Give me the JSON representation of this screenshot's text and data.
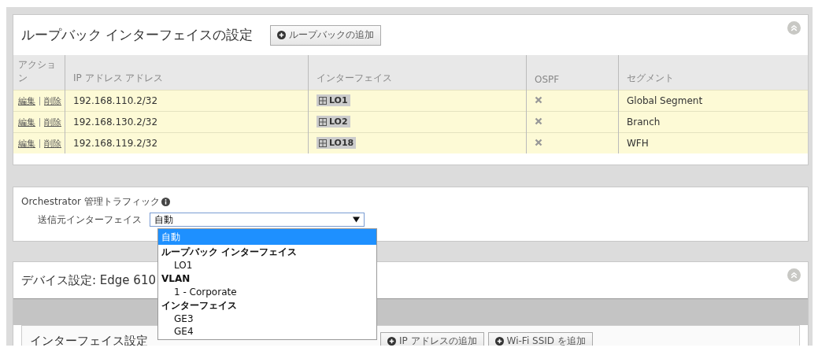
{
  "loopback": {
    "title": "ループバック インターフェイスの設定",
    "add_button": "ループバックの追加",
    "columns": [
      "アクション",
      "IP アドレス アドレス",
      "インターフェイス",
      "OSPF",
      "セグメント"
    ],
    "rows": [
      {
        "edit": "編集",
        "delete": "削除",
        "ip": "192.168.110.2/32",
        "interface": "LO1",
        "ospf": false,
        "segment": "Global Segment"
      },
      {
        "edit": "編集",
        "delete": "削除",
        "ip": "192.168.130.2/32",
        "interface": "LO2",
        "ospf": false,
        "segment": "Branch"
      },
      {
        "edit": "編集",
        "delete": "削除",
        "ip": "192.168.119.2/32",
        "interface": "LO18",
        "ospf": false,
        "segment": "WFH"
      }
    ]
  },
  "management": {
    "label": "Orchestrator 管理トラフィック",
    "source_label": "送信元インターフェイス",
    "value": "自動",
    "options": [
      {
        "kind": "option",
        "label": "自動",
        "selected": true
      },
      {
        "kind": "group",
        "label": "ループバック インターフェイス"
      },
      {
        "kind": "option",
        "label": "LO1",
        "selected": false
      },
      {
        "kind": "group",
        "label": "VLAN"
      },
      {
        "kind": "option",
        "label": "1 - Corporate",
        "selected": false
      },
      {
        "kind": "group",
        "label": "インターフェイス"
      },
      {
        "kind": "option",
        "label": "GE3",
        "selected": false
      },
      {
        "kind": "option",
        "label": "GE4",
        "selected": false
      }
    ]
  },
  "device": {
    "title": "デバイス設定: Edge 610",
    "interface_title": "インターフェイス設定",
    "buttons": [
      "IP アドレスの追加",
      "Wi-Fi SSID を追加"
    ]
  }
}
